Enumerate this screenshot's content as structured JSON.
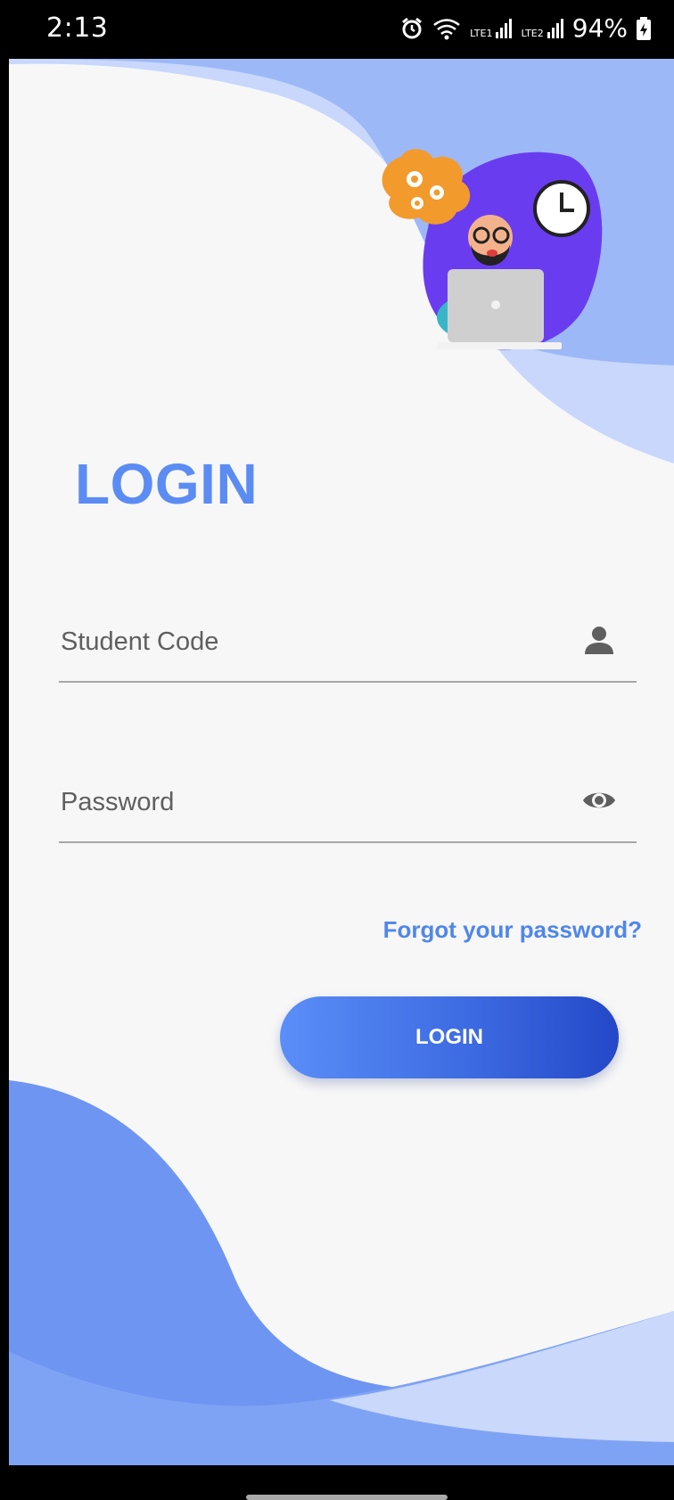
{
  "status_bar": {
    "time": "2:13",
    "net1": "LTE1",
    "net2": "LTE2",
    "battery": "94%",
    "icons": [
      "alarm-icon",
      "wifi-icon",
      "signal-icon",
      "signal-icon",
      "battery-charging-icon"
    ]
  },
  "login": {
    "title": "LOGIN",
    "student_code": {
      "placeholder": "Student Code",
      "value": "",
      "icon": "person-icon"
    },
    "password": {
      "placeholder": "Password",
      "value": "",
      "icon": "eye-icon"
    },
    "forgot_password": "Forgot your password?",
    "button_label": "LOGIN"
  },
  "colors": {
    "accent": "#5b8cf3",
    "link": "#4f86ea",
    "button_start": "#5b8ef8",
    "button_end": "#2448c8",
    "wave_light": "#c8d7fb",
    "wave_mid": "#9db8f6",
    "wave_strong": "#6e95f2",
    "background": "#f7f7f7"
  },
  "illustration": "man-with-laptop-illustration"
}
